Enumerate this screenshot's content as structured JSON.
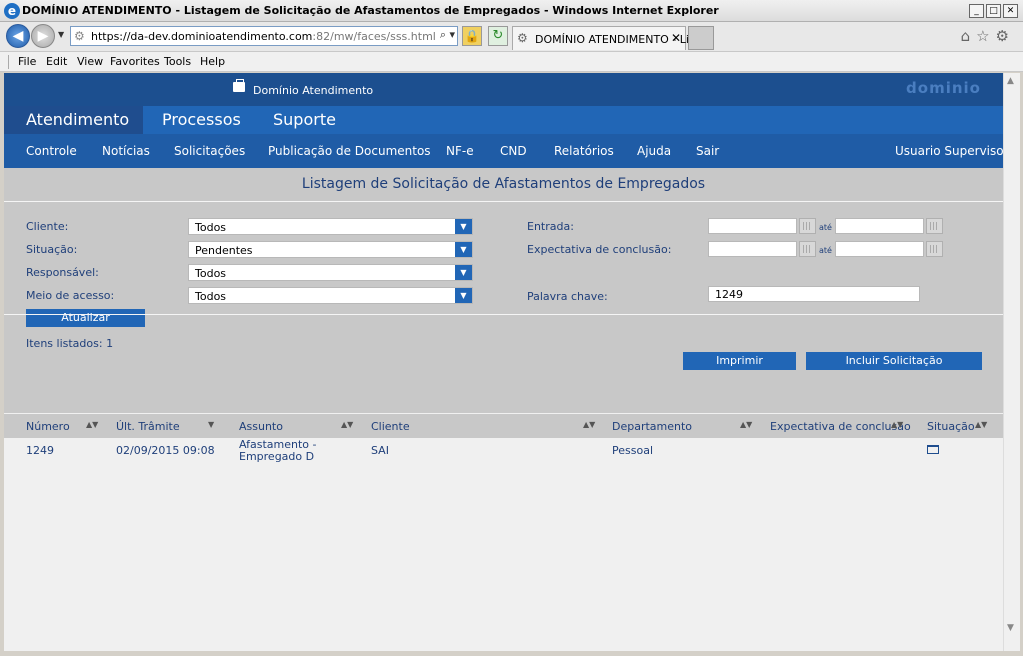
{
  "window": {
    "title": "DOMÍNIO ATENDIMENTO - Listagem de Solicitação de Afastamentos de Empregados - Windows Internet Explorer"
  },
  "browser": {
    "url_main": "https://da-dev.dominioatendimento.com",
    "url_rest": ":82/mw/faces/sss.html",
    "tab_title": "DOMÍNIO ATENDIMENTO - Li..."
  },
  "menu": [
    "File",
    "Edit",
    "View",
    "Favorites",
    "Tools",
    "Help"
  ],
  "brand": {
    "name": "Domínio Atendimento",
    "logo": "dominio"
  },
  "topnav": [
    "Atendimento",
    "Processos",
    "Suporte"
  ],
  "subnav": [
    "Controle",
    "Notícias",
    "Solicitações",
    "Publicação de Documentos",
    "NF-e",
    "CND",
    "Relatórios",
    "Ajuda",
    "Sair"
  ],
  "user": "Usuario Supervisor",
  "page_title": "Listagem de Solicitação de Afastamentos de Empregados",
  "filters": {
    "cliente": {
      "label": "Cliente:",
      "value": "Todos"
    },
    "situacao": {
      "label": "Situação:",
      "value": "Pendentes"
    },
    "responsavel": {
      "label": "Responsável:",
      "value": "Todos"
    },
    "meio": {
      "label": "Meio de acesso:",
      "value": "Todos"
    },
    "entrada": {
      "label": "Entrada:",
      "start": "",
      "end": ""
    },
    "expectativa": {
      "label": "Expectativa de conclusão:",
      "start": "",
      "end": ""
    },
    "ate": "até",
    "palavra": {
      "label": "Palavra chave:",
      "value": "1249"
    }
  },
  "buttons": {
    "atualizar": "Atualizar",
    "imprimir": "Imprimir",
    "incluir": "Incluir Solicitação"
  },
  "count": "Itens listados: 1",
  "table": {
    "headers": [
      "Número",
      "Últ. Trâmite",
      "Assunto",
      "Cliente",
      "Departamento",
      "Expectativa de conclusão",
      "Situação"
    ],
    "rows": [
      {
        "numero": "1249",
        "tramite": "02/09/2015 09:08",
        "assunto1": "Afastamento -",
        "assunto2": "Empregado D",
        "cliente": "SAI",
        "departamento": "Pessoal",
        "expectativa": ""
      }
    ]
  },
  "colors": {
    "nav_dark": "#1c4f8f",
    "nav": "#2166b6",
    "text_blue": "#1f3f7a",
    "panel": "#c8c8c8"
  }
}
